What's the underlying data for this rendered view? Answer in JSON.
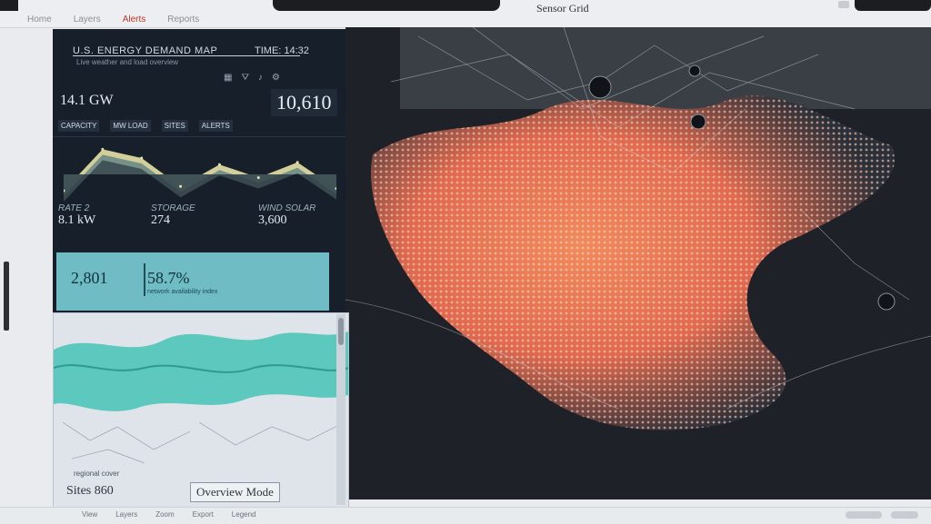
{
  "window": {
    "tabs": [
      "Home",
      "Layers",
      "Alerts",
      "Reports"
    ],
    "active_tab": 2,
    "title": "Sensor Grid"
  },
  "panel": {
    "heading": "U.S. ENERGY DEMAND MAP",
    "heading_right": "TIME: 14:32",
    "subheading": "Live weather and load overview",
    "icons": [
      "grid-icon",
      "filter-icon",
      "bell-icon",
      "gear-icon"
    ],
    "kpi_left": "14.1 GW",
    "kpi_right": "10,610",
    "labels": [
      "CAPACITY",
      "MW LOAD",
      "SITES",
      "ALERTS"
    ],
    "chart_data": {
      "type": "area",
      "values": [
        10,
        48,
        40,
        14,
        34,
        22,
        36,
        12
      ],
      "colors": [
        "#e8e2a6",
        "#6c8b86",
        "#3d4c52"
      ]
    },
    "stats": [
      {
        "title": "RATE 2",
        "value": "8.1 kW"
      },
      {
        "title": "STORAGE",
        "value": "274"
      },
      {
        "title": "WIND SOLAR",
        "value": "3,600"
      }
    ],
    "teal": {
      "a": "2,801",
      "b": "58.7%",
      "b_sub": "network availability index"
    },
    "map_overlay_tag": "regional cover",
    "footer_left": "Sites 860",
    "footer_right": "Overview Mode"
  },
  "bottom": {
    "items": [
      "View",
      "Layers",
      "Zoom",
      "Export",
      "Legend"
    ]
  },
  "colors": {
    "accent": "#c0392b",
    "panel_bg": "#17202a",
    "teal": "#6fbcc4",
    "map_bg": "#1e2228"
  }
}
